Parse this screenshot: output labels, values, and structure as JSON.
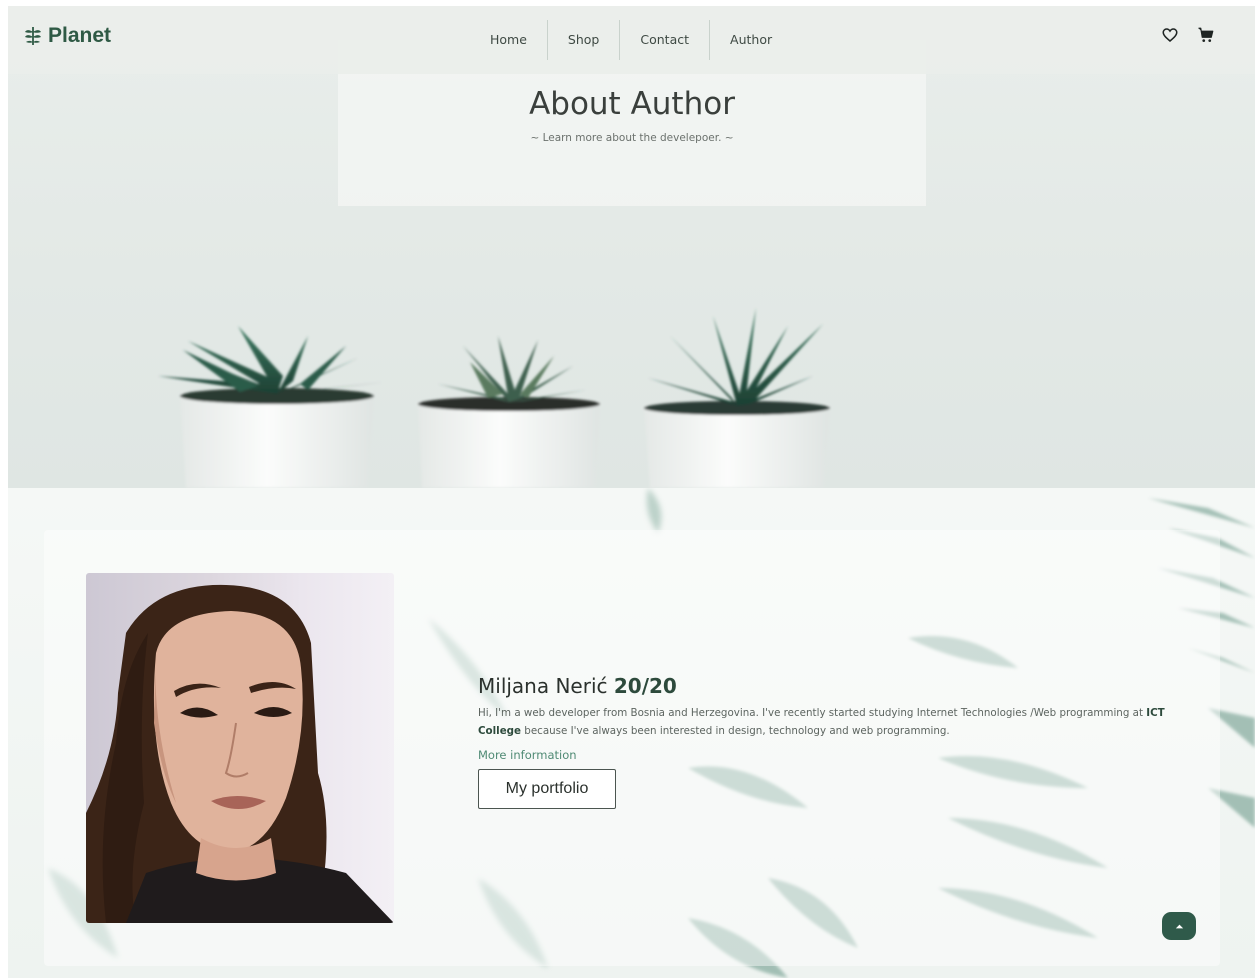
{
  "nav": {
    "brand": "Planet",
    "links": [
      "Home",
      "Shop",
      "Contact",
      "Author"
    ]
  },
  "hero": {
    "title": "About Author",
    "subtitle": "~ Learn more about the develepoer. ~"
  },
  "author": {
    "name": "Miljana Nerić",
    "score": "20/20",
    "bio_before": "Hi, I'm a web developer from Bosnia and Herzegovina. I've recently started studying Internet Technologies /Web programming at ",
    "bio_college": "ICT College",
    "bio_after": " because I've always been interested in design, technology and web programming.",
    "more_info": "More information",
    "portfolio_button": "My portfolio"
  },
  "icons": {
    "brand": "plant-logo-icon",
    "wishlist": "heart-icon",
    "cart": "cart-icon",
    "scroll_top": "chevron-up-icon"
  },
  "colors": {
    "brand": "#2f5a45",
    "accent": "#4f8a74",
    "scroll_button": "#2f5a4a"
  }
}
